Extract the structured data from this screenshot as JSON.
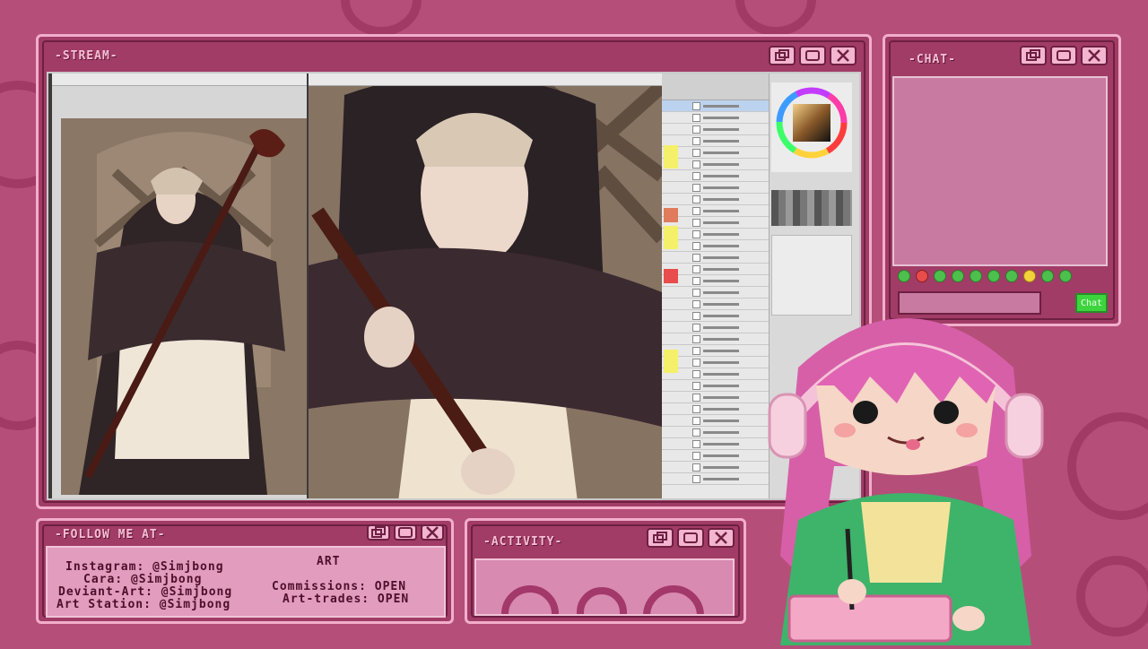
{
  "stream_panel": {
    "title": "-STREAM-"
  },
  "chat_panel": {
    "title": "-CHAT-",
    "send_label": "Chat"
  },
  "follow_panel": {
    "title": "-FOLLOW ME AT-",
    "lines": [
      "Instagram: @Simjbong",
      "Cara: @Simjbong",
      "Deviant-Art: @Simjbong",
      "Art Station: @Simjbong"
    ],
    "art_heading": "ART",
    "status_lines": [
      "Commissions: OPEN",
      "Art-trades: OPEN"
    ]
  },
  "activity_panel": {
    "title": "-ACTIVITY-"
  },
  "colors": {
    "panel": "#a13c66",
    "border": "#f2aecb",
    "text": "#4e0f2c",
    "accent_green": "#3ed43e"
  },
  "icons": [
    "restore-icon",
    "maximize-icon",
    "close-icon"
  ]
}
